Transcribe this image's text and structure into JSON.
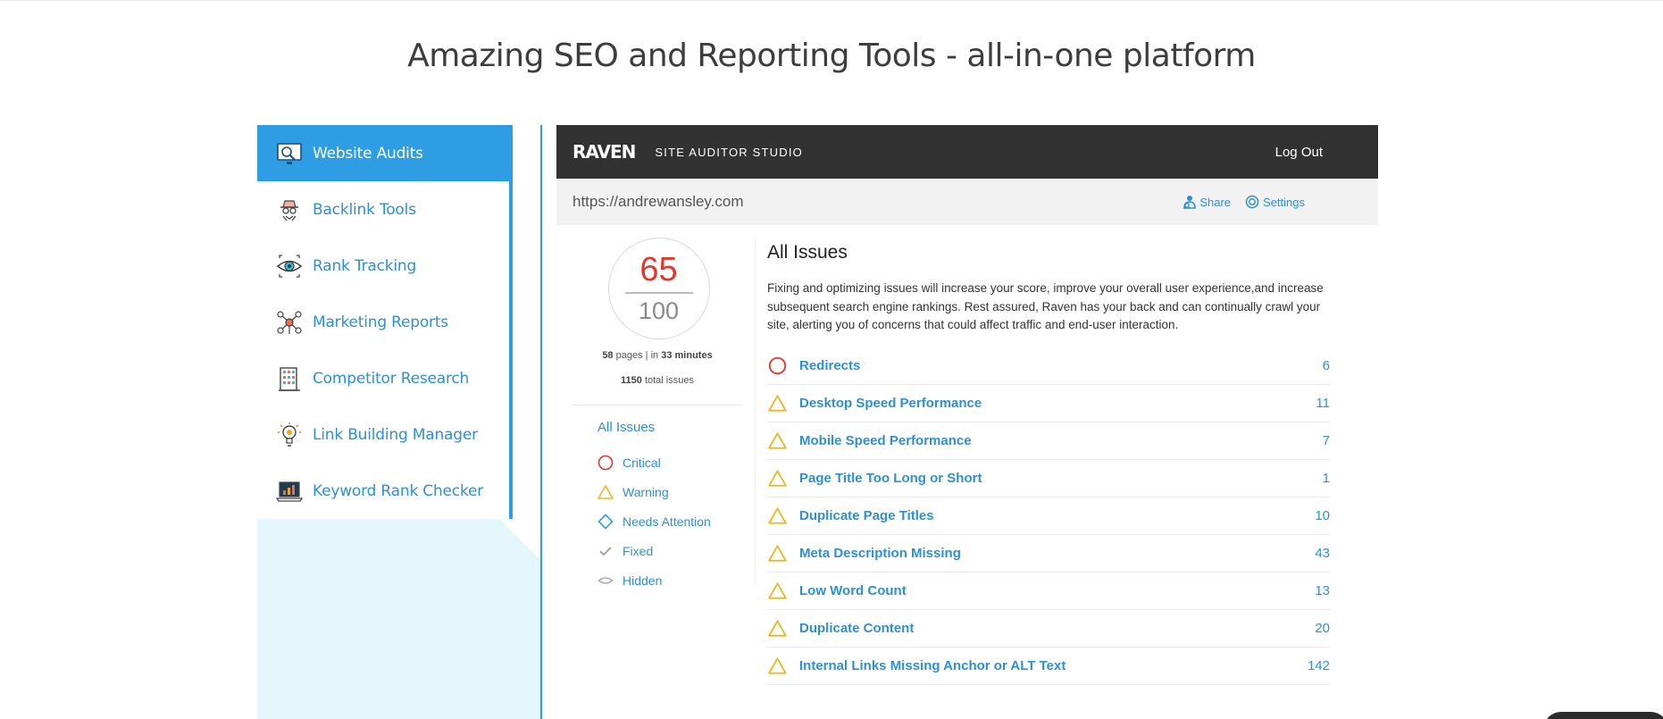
{
  "headline": "Amazing SEO and Reporting Tools - all-in-one platform",
  "tools": [
    {
      "label": "Website Audits",
      "icon": "website-audit-icon",
      "active": true
    },
    {
      "label": "Backlink Tools",
      "icon": "spy-icon"
    },
    {
      "label": "Rank Tracking",
      "icon": "eye-icon"
    },
    {
      "label": "Marketing Reports",
      "icon": "network-icon"
    },
    {
      "label": "Competitor Research",
      "icon": "building-icon"
    },
    {
      "label": "Link Building Manager",
      "icon": "lightbulb-icon"
    },
    {
      "label": "Keyword Rank Checker",
      "icon": "laptop-chart-icon"
    }
  ],
  "app": {
    "logo": "RAVEN",
    "product": "SITE AUDITOR STUDIO",
    "logout": "Log Out",
    "url": "https://andrewansley.com",
    "share": "Share",
    "settings": "Settings"
  },
  "score": {
    "value": "65",
    "max": "100",
    "pages_count": "58",
    "pages_label": "pages",
    "separator": "|",
    "time_prefix": "in",
    "time_value": "33 minutes",
    "issues_count": "1150",
    "issues_label": "total issues"
  },
  "filters": {
    "title": "All Issues",
    "items": [
      {
        "label": "Critical",
        "icon": "critical-circle-icon"
      },
      {
        "label": "Warning",
        "icon": "warning-triangle-icon"
      },
      {
        "label": "Needs Attention",
        "icon": "attention-diamond-icon"
      },
      {
        "label": "Fixed",
        "icon": "checkmark-icon"
      },
      {
        "label": "Hidden",
        "icon": "hidden-eye-icon"
      }
    ]
  },
  "issues": {
    "title": "All Issues",
    "description": "Fixing and optimizing issues will increase your score, improve your overall user experience,and increase subsequent search engine rankings. Rest assured, Raven has your back and can continually crawl your site, alerting you of concerns that could affect traffic and end-user interaction.",
    "rows": [
      {
        "label": "Redirects",
        "count": "6",
        "severity": "critical"
      },
      {
        "label": "Desktop Speed Performance",
        "count": "11",
        "severity": "warning"
      },
      {
        "label": "Mobile Speed Performance",
        "count": "7",
        "severity": "warning"
      },
      {
        "label": "Page Title Too Long or Short",
        "count": "1",
        "severity": "warning"
      },
      {
        "label": "Duplicate Page Titles",
        "count": "10",
        "severity": "warning"
      },
      {
        "label": "Meta Description Missing",
        "count": "43",
        "severity": "warning"
      },
      {
        "label": "Low Word Count",
        "count": "13",
        "severity": "warning"
      },
      {
        "label": "Duplicate Content",
        "count": "20",
        "severity": "warning"
      },
      {
        "label": "Internal Links Missing Anchor or ALT Text",
        "count": "142",
        "severity": "warning"
      }
    ]
  },
  "colors": {
    "accent": "#2f9de4",
    "link": "#2f8fd3",
    "critical": "#e03a2f",
    "warning": "#e8b923",
    "attention": "#2f9de4",
    "appbar": "#323232"
  }
}
